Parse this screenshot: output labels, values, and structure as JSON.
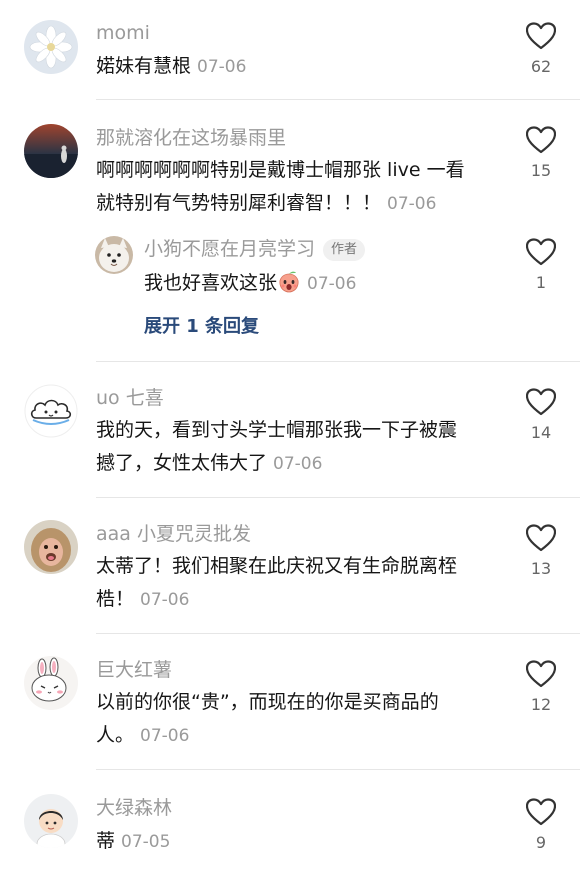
{
  "comments": [
    {
      "username": "momi",
      "text": "婼妹有慧根",
      "time": "07-06",
      "likes": "62",
      "avatar_icon": "white-flower-avatar"
    },
    {
      "username": "那就溶化在这场暴雨里",
      "text_line1": "啊啊啊啊啊啊特别是戴博士帽那张 live 一看",
      "text_line2": "就特别有气势特别犀利睿智！！！",
      "time": "07-06",
      "likes": "15",
      "avatar_icon": "sunset-figure-avatar",
      "reply": {
        "username": "小狗不愿在月亮学习",
        "badge": "作者",
        "text": "我也好喜欢这张",
        "emoji": "peach-face-emoji",
        "time": "07-06",
        "likes": "1",
        "avatar_icon": "samoyed-dog-avatar"
      },
      "expand_label": "展开 1 条回复"
    },
    {
      "username": "uo 七喜",
      "text_line1": "我的天，看到寸头学士帽那张我一下子被震",
      "text_line2": "撼了，女性太伟大了",
      "time": "07-06",
      "likes": "14",
      "avatar_icon": "cloud-face-avatar"
    },
    {
      "username": "aaa 小夏咒灵批发",
      "text_line1": "太蒂了！我们相聚在此庆祝又有生命脱离桎",
      "text_line2": "梏！",
      "time": "07-06",
      "likes": "13",
      "avatar_icon": "monkey-avatar"
    },
    {
      "username": "巨大红薯",
      "text_line1": "以前的你很“贵”，而现在的你是买商品的",
      "text_line2": "人。",
      "time": "07-06",
      "likes": "12",
      "avatar_icon": "bunny-sticker-avatar"
    },
    {
      "username": "大绿森林",
      "text": "蒂",
      "time": "07-05",
      "likes": "9",
      "avatar_icon": "cartoon-boy-avatar"
    }
  ],
  "colors": {
    "username": "#9a9a9a",
    "text": "#161616",
    "link": "#2a4a7a",
    "divider": "#e6e6e6"
  }
}
